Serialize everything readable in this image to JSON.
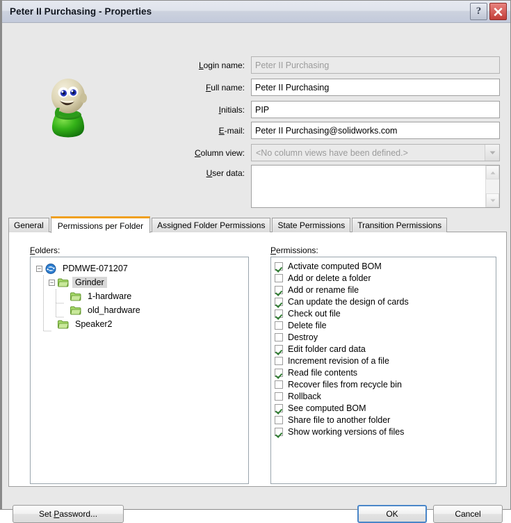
{
  "window": {
    "title": "Peter II Purchasing - Properties",
    "help_button": "?",
    "close_button": "✕"
  },
  "form": {
    "login_name": {
      "label": "Login name:",
      "accel": "L",
      "value": "Peter II Purchasing",
      "readonly": true
    },
    "full_name": {
      "label": "Full name:",
      "accel": "F",
      "value": "Peter II Purchasing"
    },
    "initials": {
      "label": "Initials:",
      "accel": "I",
      "value": "PIP"
    },
    "email": {
      "label": "E-mail:",
      "accel": "E",
      "value": "Peter II Purchasing@solidworks.com"
    },
    "column_view": {
      "label": "Column view:",
      "accel": "C",
      "value": "<No column views have been defined.>",
      "disabled": true
    },
    "user_data": {
      "label": "User data:",
      "accel": "U",
      "value": ""
    }
  },
  "tabs": [
    {
      "label": "General",
      "active": false
    },
    {
      "label": "Permissions per Folder",
      "active": true
    },
    {
      "label": "Assigned Folder Permissions",
      "active": false
    },
    {
      "label": "State Permissions",
      "active": false
    },
    {
      "label": "Transition Permissions",
      "active": false
    }
  ],
  "folders_panel": {
    "title": "Folders:",
    "accel": "F",
    "tree": [
      {
        "label": "PDMWE-071207",
        "depth": 0,
        "icon": "vault-icon",
        "expander": "minus",
        "selected": false
      },
      {
        "label": "Grinder",
        "depth": 1,
        "icon": "folder-icon",
        "expander": "minus",
        "selected": true
      },
      {
        "label": "1-hardware",
        "depth": 2,
        "icon": "folder-icon",
        "expander": "none",
        "selected": false
      },
      {
        "label": "old_hardware",
        "depth": 2,
        "icon": "folder-icon",
        "expander": "none",
        "selected": false
      },
      {
        "label": "Speaker2",
        "depth": 1,
        "icon": "folder-icon",
        "expander": "none",
        "selected": false
      }
    ]
  },
  "permissions_panel": {
    "title": "Permissions:",
    "accel": "P",
    "items": [
      {
        "label": "Activate computed BOM",
        "checked": true
      },
      {
        "label": "Add or delete a folder",
        "checked": false
      },
      {
        "label": "Add or rename file",
        "checked": true
      },
      {
        "label": "Can update the design of cards",
        "checked": true
      },
      {
        "label": "Check out file",
        "checked": true
      },
      {
        "label": "Delete file",
        "checked": false
      },
      {
        "label": "Destroy",
        "checked": false
      },
      {
        "label": "Edit folder card data",
        "checked": true
      },
      {
        "label": "Increment revision of a file",
        "checked": false
      },
      {
        "label": "Read file contents",
        "checked": true
      },
      {
        "label": "Recover files from recycle bin",
        "checked": false
      },
      {
        "label": "Rollback",
        "checked": false
      },
      {
        "label": "See computed BOM",
        "checked": true
      },
      {
        "label": "Share file to another folder",
        "checked": false
      },
      {
        "label": "Show working versions of files",
        "checked": true
      }
    ]
  },
  "footer": {
    "set_password": "Set Password...",
    "set_password_accel": "P",
    "ok": "OK",
    "cancel": "Cancel"
  },
  "colors": {
    "active_tab_accent": "#f0a020",
    "check_green": "#2f7d32",
    "focus_blue": "#4a86c8",
    "close_red": "#c23d38",
    "selection_gray": "#d8d8d8"
  }
}
